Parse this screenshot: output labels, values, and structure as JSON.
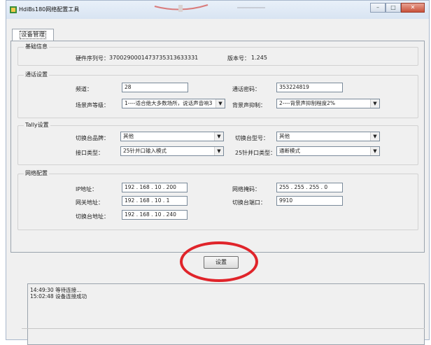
{
  "window": {
    "title": "HdiBs180网络配置工具",
    "buttons": {
      "minimize": "–",
      "maximize": "□",
      "close": "✕"
    }
  },
  "tab": {
    "label": "设备管理"
  },
  "basic": {
    "legend": "基础信息",
    "serial_label": "硬件序列号：",
    "serial_value": "3700290001473735313633331",
    "version_label": "版本号：",
    "version_value": "1.245"
  },
  "comm": {
    "legend": "通话设置",
    "channel_label": "频道：",
    "channel_value": "28",
    "password_label": "通话密码：",
    "password_value": "353224819",
    "scene_label": "场景声等级：",
    "scene_value": "1----适合绝大多数场所，说话声音响3",
    "bg_label": "背景声抑制：",
    "bg_value": "2----背景声抑制程度2%"
  },
  "tally": {
    "legend": "Tally设置",
    "brand_label": "切换台品牌：",
    "brand_value": "其他",
    "model_label": "切换台型号：",
    "model_value": "其他",
    "port_label": "接口类型：",
    "port_value": "25针并口输入模式",
    "pin_label": "25针并口类型：",
    "pin_value": "通断模式"
  },
  "network": {
    "legend": "网络配置",
    "ip_label": "IP地址：",
    "ip_value": "192 . 168 . 10 . 200",
    "mask_label": "网络掩码：",
    "mask_value": "255 . 255 . 255 . 0",
    "gateway_label": "网关地址：",
    "gateway_value": "192 . 168 . 10 . 1",
    "switch_port_label": "切换台端口：",
    "switch_port_value": "9910",
    "switch_addr_label": "切换台地址：",
    "switch_addr_value": "192 . 168 . 10 . 240"
  },
  "set_button": "设置",
  "log": {
    "line1": "14:49:30 等待连接...",
    "line2": "15:02:48 设备连接成功"
  },
  "colors": {
    "highlight_circle": "#e0242a"
  }
}
